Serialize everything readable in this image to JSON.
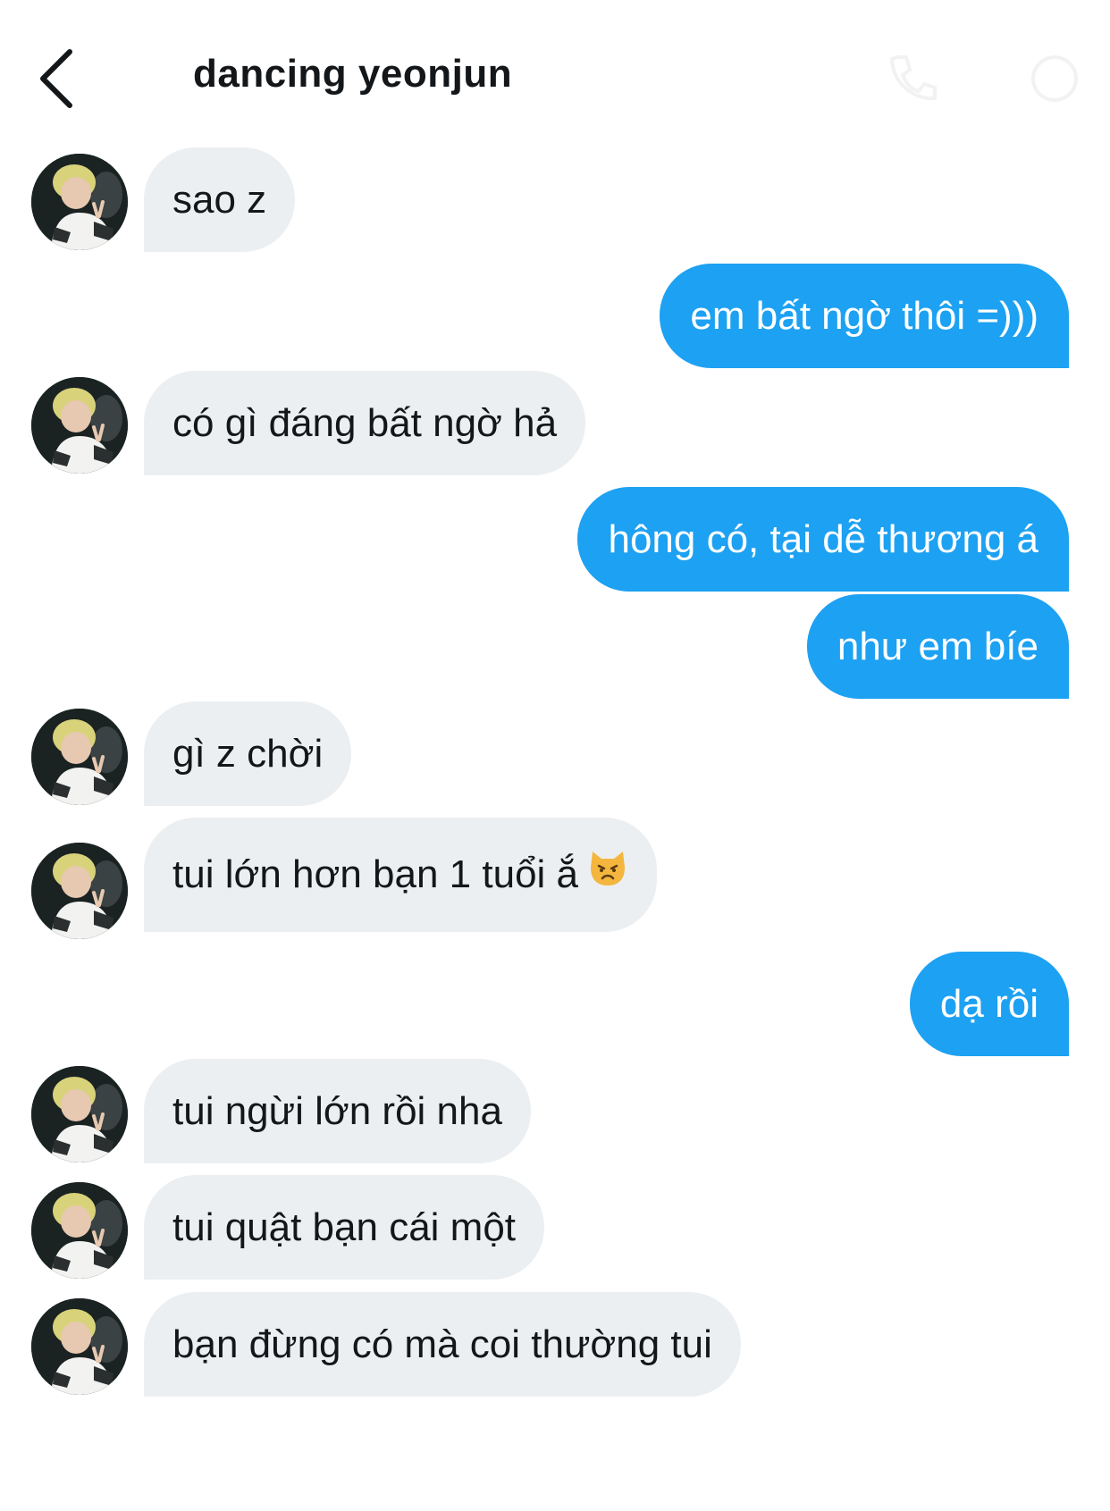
{
  "header": {
    "title": "dancing yeonjun",
    "back_icon": "chevron-left-icon",
    "right_icons": [
      "phone-icon",
      "info-icon"
    ]
  },
  "messages": [
    {
      "direction": "incoming",
      "text": "sao z"
    },
    {
      "direction": "outgoing",
      "text": "em bất ngờ thôi =)))"
    },
    {
      "direction": "incoming",
      "text": "có gì đáng bất ngờ hả"
    },
    {
      "direction": "outgoing",
      "text": "hông có, tại dễ thương á"
    },
    {
      "direction": "outgoing",
      "text": "như em bíe"
    },
    {
      "direction": "incoming",
      "text": "gì z chời"
    },
    {
      "direction": "incoming",
      "text": "tui lớn hơn bạn 1 tuổi ắ",
      "emoji": "pouting-cat-emoji"
    },
    {
      "direction": "outgoing",
      "text": "dạ rồi"
    },
    {
      "direction": "incoming",
      "text": "tui ngừi lớn rồi nha"
    },
    {
      "direction": "incoming",
      "text": "tui quật bạn cái một"
    },
    {
      "direction": "incoming",
      "text": "bạn đừng có mà coi thường tui"
    }
  ],
  "colors": {
    "outgoing_bubble": "#1da1f2",
    "incoming_bubble": "#eceff1",
    "text": "#14171a"
  }
}
